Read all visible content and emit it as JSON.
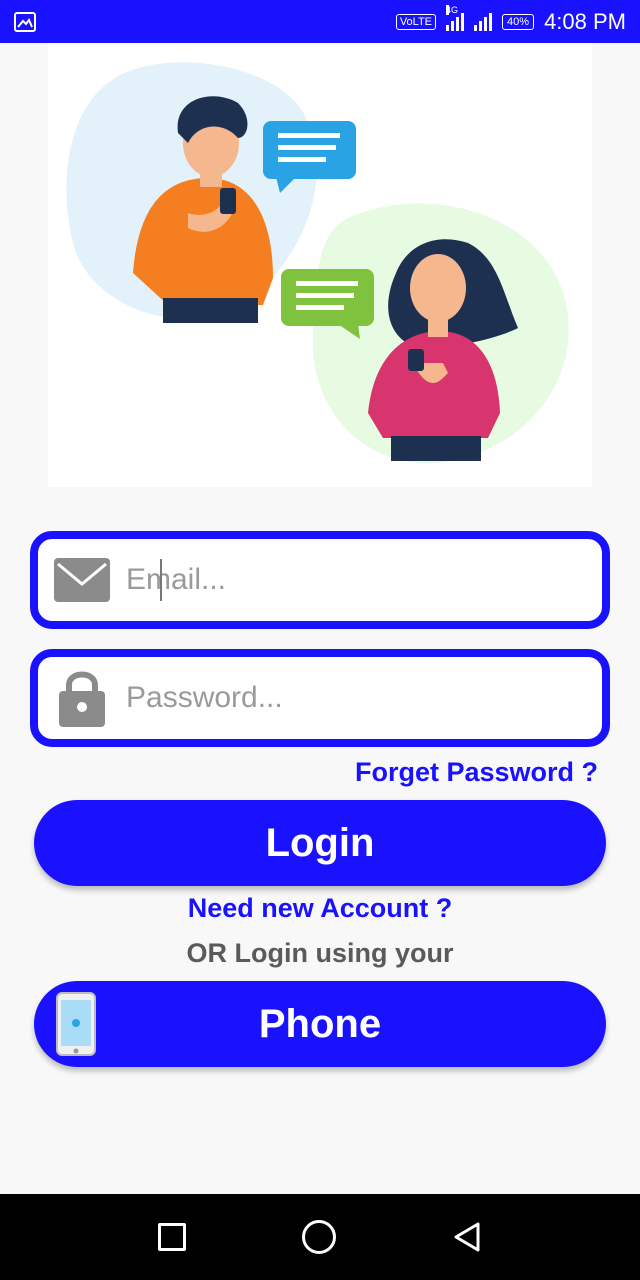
{
  "status_bar": {
    "volte": "VoLTE",
    "network": "4G",
    "battery": "40%",
    "time": "4:08 PM"
  },
  "form": {
    "email_placeholder": "Email...",
    "password_placeholder": "Password...",
    "forget_password": "Forget Password ?",
    "login_label": "Login",
    "need_account": "Need new Account ?",
    "or_login": "OR Login using your",
    "phone_label": "Phone"
  },
  "colors": {
    "accent": "#1a12ff",
    "status_bar": "#1a12ff",
    "nav_bar": "#000000"
  },
  "icons": {
    "email": "envelope-icon",
    "password": "lock-icon",
    "phone": "smartphone-icon"
  }
}
